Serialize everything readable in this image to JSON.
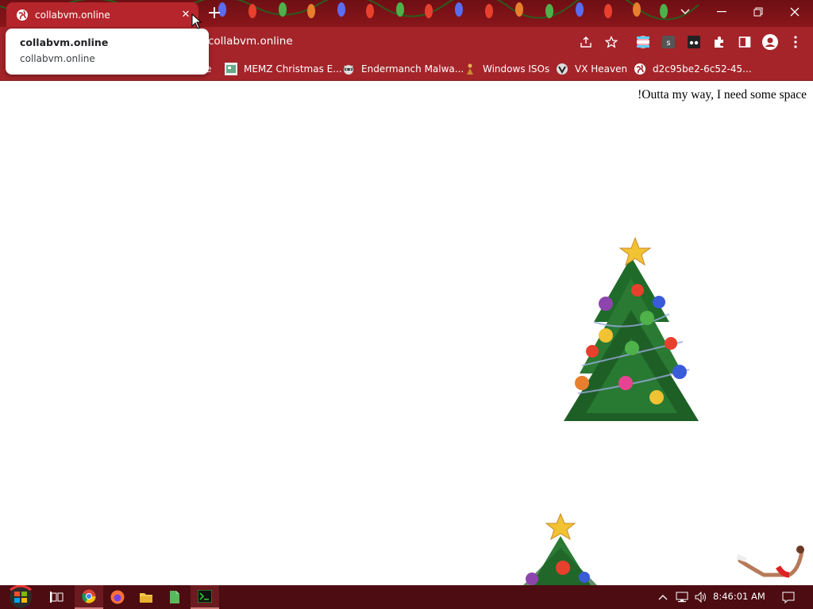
{
  "browser": {
    "tab_title": "collabvm.online",
    "address": "collabvm.online",
    "accent_color": "#a4242a",
    "tabstrip_color": "#7a1218"
  },
  "tooltip": {
    "title": "collabvm.online",
    "url": "collabvm.online"
  },
  "bookmarks": [
    {
      "label": "e",
      "icon": "bookmark-icon"
    },
    {
      "label": "MEMZ Christmas E...",
      "icon": "memz-icon"
    },
    {
      "label": "Endermanch Malwa...",
      "icon": "raccoon-icon"
    },
    {
      "label": "Windows ISOs",
      "icon": "figure-icon"
    },
    {
      "label": "VX Heaven",
      "icon": "vx-icon"
    },
    {
      "label": "d2c95be2-6c52-45...",
      "icon": "globe-icon"
    }
  ],
  "page": {
    "messages": [
      "!Outta my way, I need some space"
    ]
  },
  "taskbar": {
    "clock": "8:46:01 AM",
    "background": "#4c0c11"
  }
}
